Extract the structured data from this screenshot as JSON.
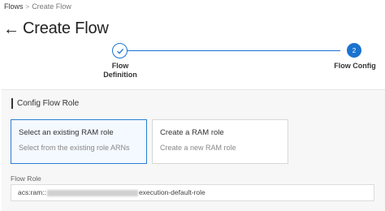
{
  "breadcrumb": {
    "items": [
      "Flows",
      "Create Flow"
    ],
    "separator": ">"
  },
  "header": {
    "title": "Create Flow",
    "back_icon": "arrow-left-icon"
  },
  "stepper": {
    "accent_color": "#1a73d0",
    "steps": [
      {
        "label": "Flow Definition",
        "status": "completed",
        "icon": "check-icon"
      },
      {
        "label": "Flow Config",
        "status": "active",
        "number": "2"
      }
    ]
  },
  "section": {
    "title": "Config Flow Role"
  },
  "role_options": [
    {
      "title": "Select an existing RAM role",
      "description": "Select from the existing role ARNs",
      "selected": true
    },
    {
      "title": "Create a RAM role",
      "description": "Create a new RAM role",
      "selected": false
    }
  ],
  "flow_role": {
    "label": "Flow Role",
    "value_prefix": "acs:ram::",
    "value_suffix": "execution-default-role"
  }
}
